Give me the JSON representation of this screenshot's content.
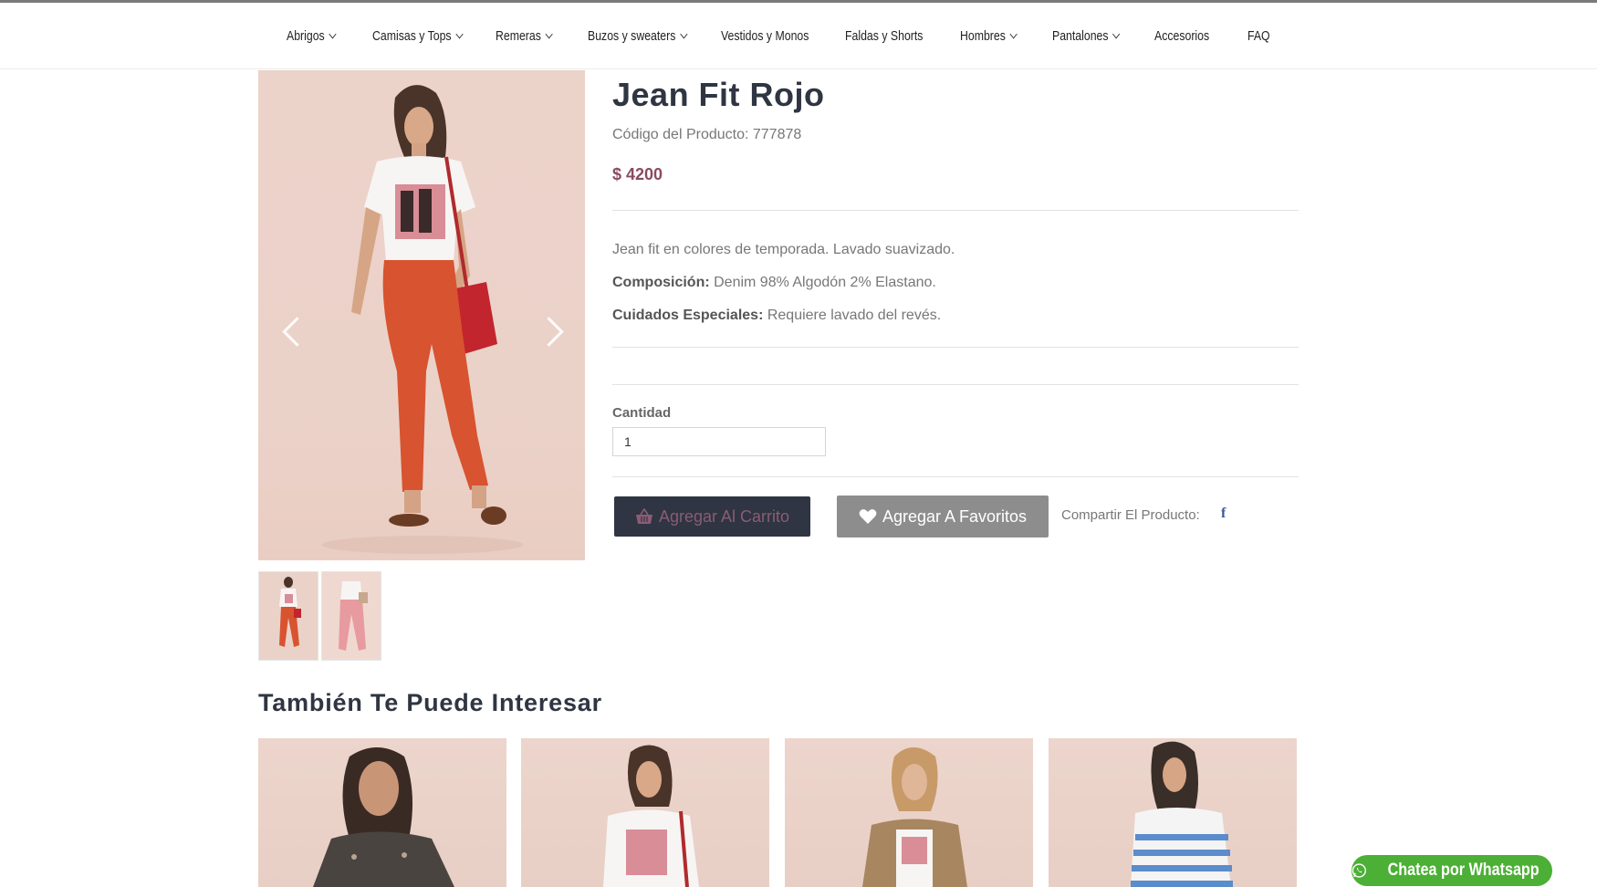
{
  "nav": {
    "items": [
      {
        "label": "Abrigos",
        "dropdown": true
      },
      {
        "label": "Camisas y Tops",
        "dropdown": true
      },
      {
        "label": "Remeras",
        "dropdown": true
      },
      {
        "label": "Buzos y sweaters",
        "dropdown": true
      },
      {
        "label": "Vestidos y Monos",
        "dropdown": false
      },
      {
        "label": "Faldas y Shorts",
        "dropdown": false
      },
      {
        "label": "Hombres",
        "dropdown": true
      },
      {
        "label": "Pantalones",
        "dropdown": true
      },
      {
        "label": "Accesorios",
        "dropdown": false
      },
      {
        "label": "FAQ",
        "dropdown": false
      }
    ]
  },
  "product": {
    "title": "Jean Fit Rojo",
    "code": "Código del Producto: 777878",
    "price": "$ 4200",
    "description": "Jean fit en colores de temporada. Lavado suavizado.",
    "composition_label": "Composición:",
    "composition_value": " Denim 98% Algodón 2% Elastano.",
    "care_label": "Cuidados Especiales:",
    "care_value": " Requiere lavado del revés.",
    "quantity_label": "Cantidad",
    "quantity_value": "1",
    "add_to_cart": "Agregar Al Carrito",
    "add_to_favorites": "Agregar A Favoritos",
    "share_label": "Compartir El Producto:",
    "facebook_icon": "f"
  },
  "related": {
    "title": "También Te Puede Interesar"
  },
  "whatsapp": {
    "label": "Chatea por Whatsapp"
  },
  "colors": {
    "dark": "#2f3542",
    "price": "#8a4a5d",
    "whatsapp": "#4caf36",
    "facebook": "#3b5998"
  },
  "icons": [
    "chevron-down-icon",
    "chevron-left-icon",
    "chevron-right-icon",
    "basket-icon",
    "heart-icon",
    "facebook-icon",
    "whatsapp-icon"
  ]
}
